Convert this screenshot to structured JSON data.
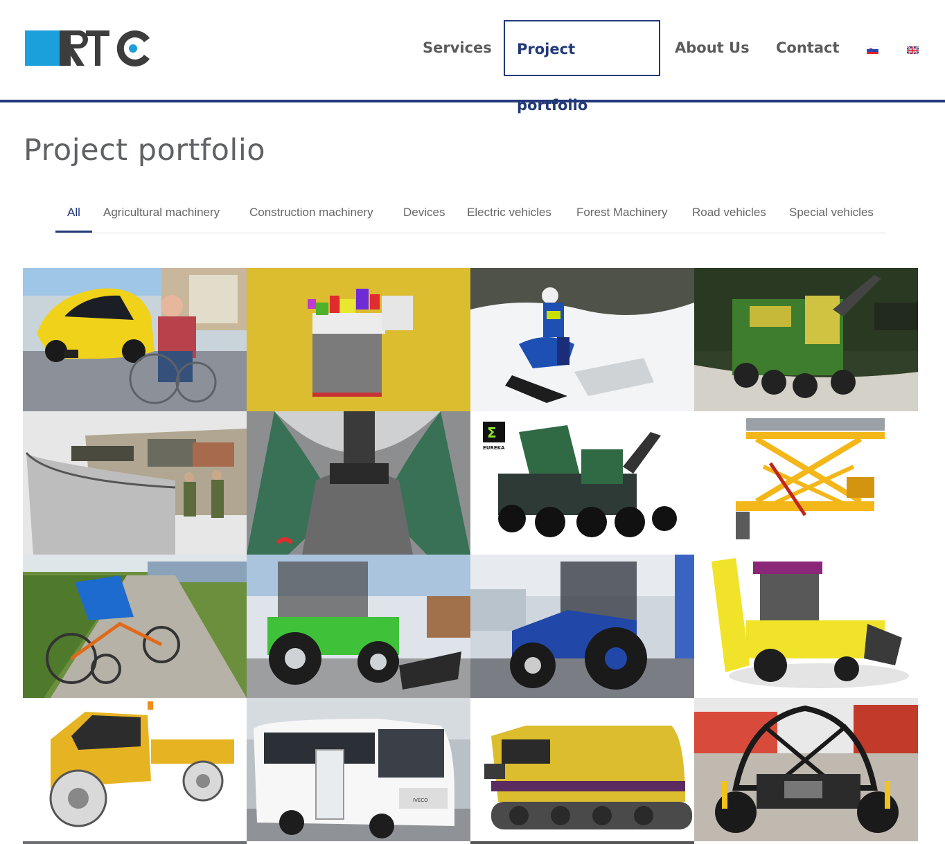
{
  "brand": {
    "logo_text": "RTC",
    "accent": "#1ba0dc",
    "dark": "#3d3d3d",
    "navy": "#233a78"
  },
  "nav": {
    "items": [
      {
        "label": "Services",
        "active": false
      },
      {
        "label": "Project portfolio",
        "active": true
      },
      {
        "label": "About Us",
        "active": false
      },
      {
        "label": "Contact",
        "active": false
      }
    ],
    "languages": [
      "slovenian-flag-icon",
      "uk-flag-icon"
    ]
  },
  "page": {
    "title": "Project portfolio"
  },
  "filters": {
    "tabs": [
      {
        "label": "All",
        "active": true
      },
      {
        "label": "Agricultural machinery",
        "active": false
      },
      {
        "label": "Construction machinery",
        "active": false
      },
      {
        "label": "Devices",
        "active": false
      },
      {
        "label": "Electric vehicles",
        "active": false
      },
      {
        "label": "Forest Machinery",
        "active": false
      },
      {
        "label": "Road vehicles",
        "active": false
      },
      {
        "label": "Special vehicles",
        "active": false
      }
    ]
  },
  "portfolio": {
    "tiles": [
      {
        "subject": "yellow-electric-microcar",
        "text": ""
      },
      {
        "subject": "battery-pack-render",
        "text": ""
      },
      {
        "subject": "snow-motorcycle",
        "text": ""
      },
      {
        "subject": "green-forest-harvester",
        "text": ""
      },
      {
        "subject": "military-simulator",
        "text": ""
      },
      {
        "subject": "cockpit-interior",
        "text": ""
      },
      {
        "subject": "forestry-forwarder",
        "text": "EUREKA"
      },
      {
        "subject": "scissor-lift-frame",
        "text": ""
      },
      {
        "subject": "recumbent-trike",
        "text": ""
      },
      {
        "subject": "green-forestry-tractor",
        "text": ""
      },
      {
        "subject": "blue-tractor",
        "text": ""
      },
      {
        "subject": "yellow-backhoe-loader",
        "text": ""
      },
      {
        "subject": "yellow-utility-truck",
        "text": ""
      },
      {
        "subject": "white-minibus",
        "text": "IVECO"
      },
      {
        "subject": "tracked-yellow-vehicle",
        "text": ""
      },
      {
        "subject": "black-offroad-buggy",
        "text": ""
      }
    ]
  }
}
